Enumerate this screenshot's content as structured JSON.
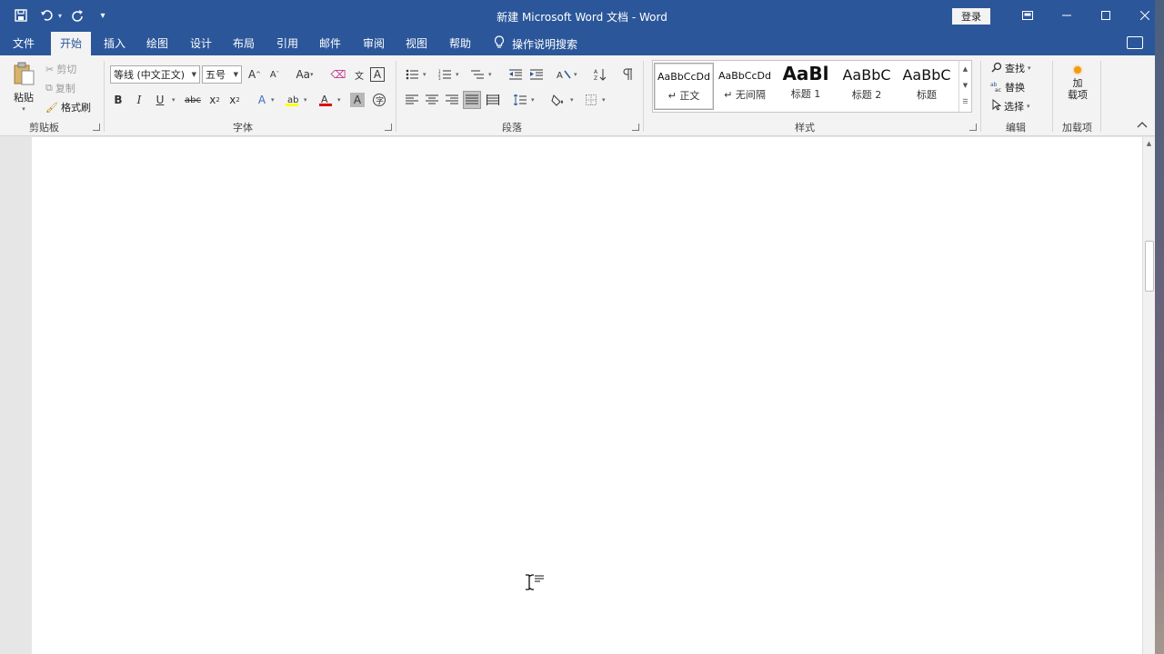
{
  "window": {
    "title": "新建 Microsoft Word 文档 - Word",
    "login_label": "登录"
  },
  "ribbon_tabs": [
    "文件",
    "开始",
    "插入",
    "绘图",
    "设计",
    "布局",
    "引用",
    "邮件",
    "审阅",
    "视图",
    "帮助"
  ],
  "active_tab": "开始",
  "tell_me": "操作说明搜索",
  "clipboard": {
    "paste": "粘贴",
    "cut": "剪切",
    "copy": "复制",
    "format_painter": "格式刷",
    "group_label": "剪贴板"
  },
  "font": {
    "font_name": "等线 (中文正文)",
    "font_size": "五号",
    "group_label": "字体"
  },
  "paragraph": {
    "group_label": "段落"
  },
  "styles": {
    "items": [
      {
        "preview": "AaBbCcDd",
        "name": "正文"
      },
      {
        "preview": "AaBbCcDd",
        "name": "无间隔"
      },
      {
        "preview": "AaBl",
        "name": "标题 1"
      },
      {
        "preview": "AaBbC",
        "name": "标题 2"
      },
      {
        "preview": "AaBbC",
        "name": "标题"
      }
    ],
    "group_label": "样式"
  },
  "editing": {
    "find": "查找",
    "replace": "替换",
    "select": "选择",
    "group_label": "编辑"
  },
  "addins": {
    "button": "加\n载项",
    "group_label": "加载项"
  },
  "colors": {
    "title_bar": "#2b579a",
    "ribbon_bg": "#f3f3f3",
    "highlight_yellow": "#ffff00",
    "font_color_red": "#e00000",
    "addin_orange": "#f39c12"
  },
  "icons": [
    "save-icon",
    "undo-icon",
    "redo-icon",
    "customize-qat-icon",
    "restore-ribbon-icon",
    "minimize-icon",
    "maximize-icon",
    "close-icon",
    "lightbulb-icon",
    "comment-icon",
    "paste-icon",
    "cut-icon",
    "copy-icon",
    "format-painter-icon",
    "find-icon",
    "replace-icon",
    "select-icon",
    "addins-icon",
    "text-cursor-icon",
    "paragraph-mark-icon"
  ]
}
